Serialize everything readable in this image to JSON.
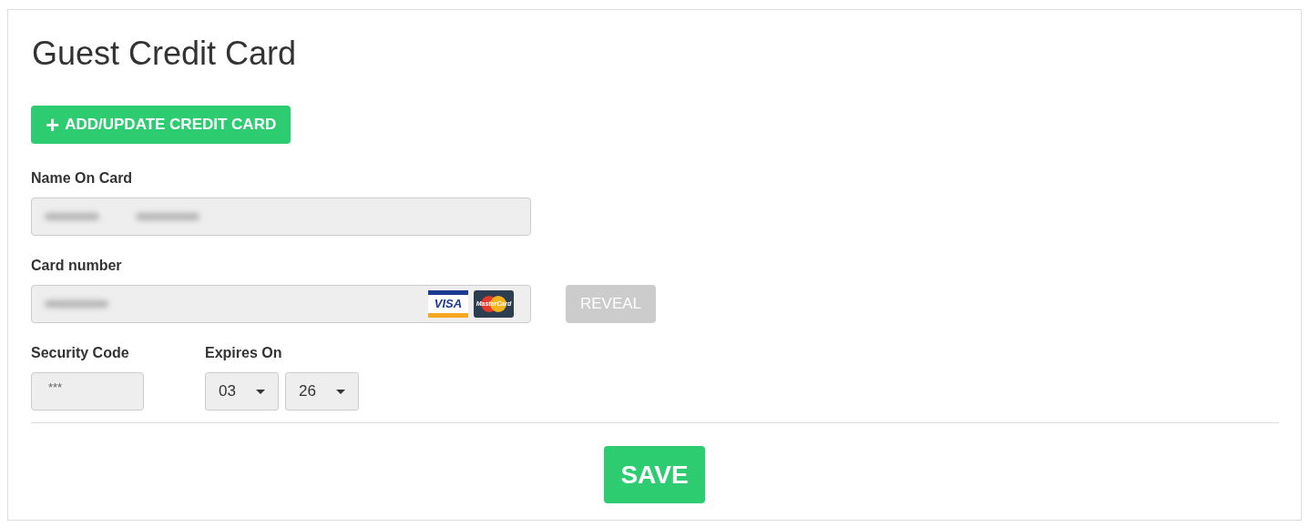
{
  "title": "Guest Credit Card",
  "add_button": {
    "icon": "+",
    "label": "ADD/UPDATE CREDIT CARD"
  },
  "name_field": {
    "label": "Name On Card",
    "disabled": true
  },
  "card_number_field": {
    "label": "Card number",
    "disabled": true,
    "card_logos": [
      {
        "kind": "visa",
        "label": "VISA"
      },
      {
        "kind": "mastercard",
        "label": "MasterCard"
      }
    ]
  },
  "reveal_button": {
    "label": "REVEAL",
    "disabled": true
  },
  "security_code_field": {
    "label": "Security Code",
    "value": "***",
    "disabled": true
  },
  "expires": {
    "label": "Expires On",
    "selects": [
      {
        "value": "03"
      },
      {
        "value": "26"
      }
    ]
  },
  "save_button": {
    "label": "SAVE"
  }
}
